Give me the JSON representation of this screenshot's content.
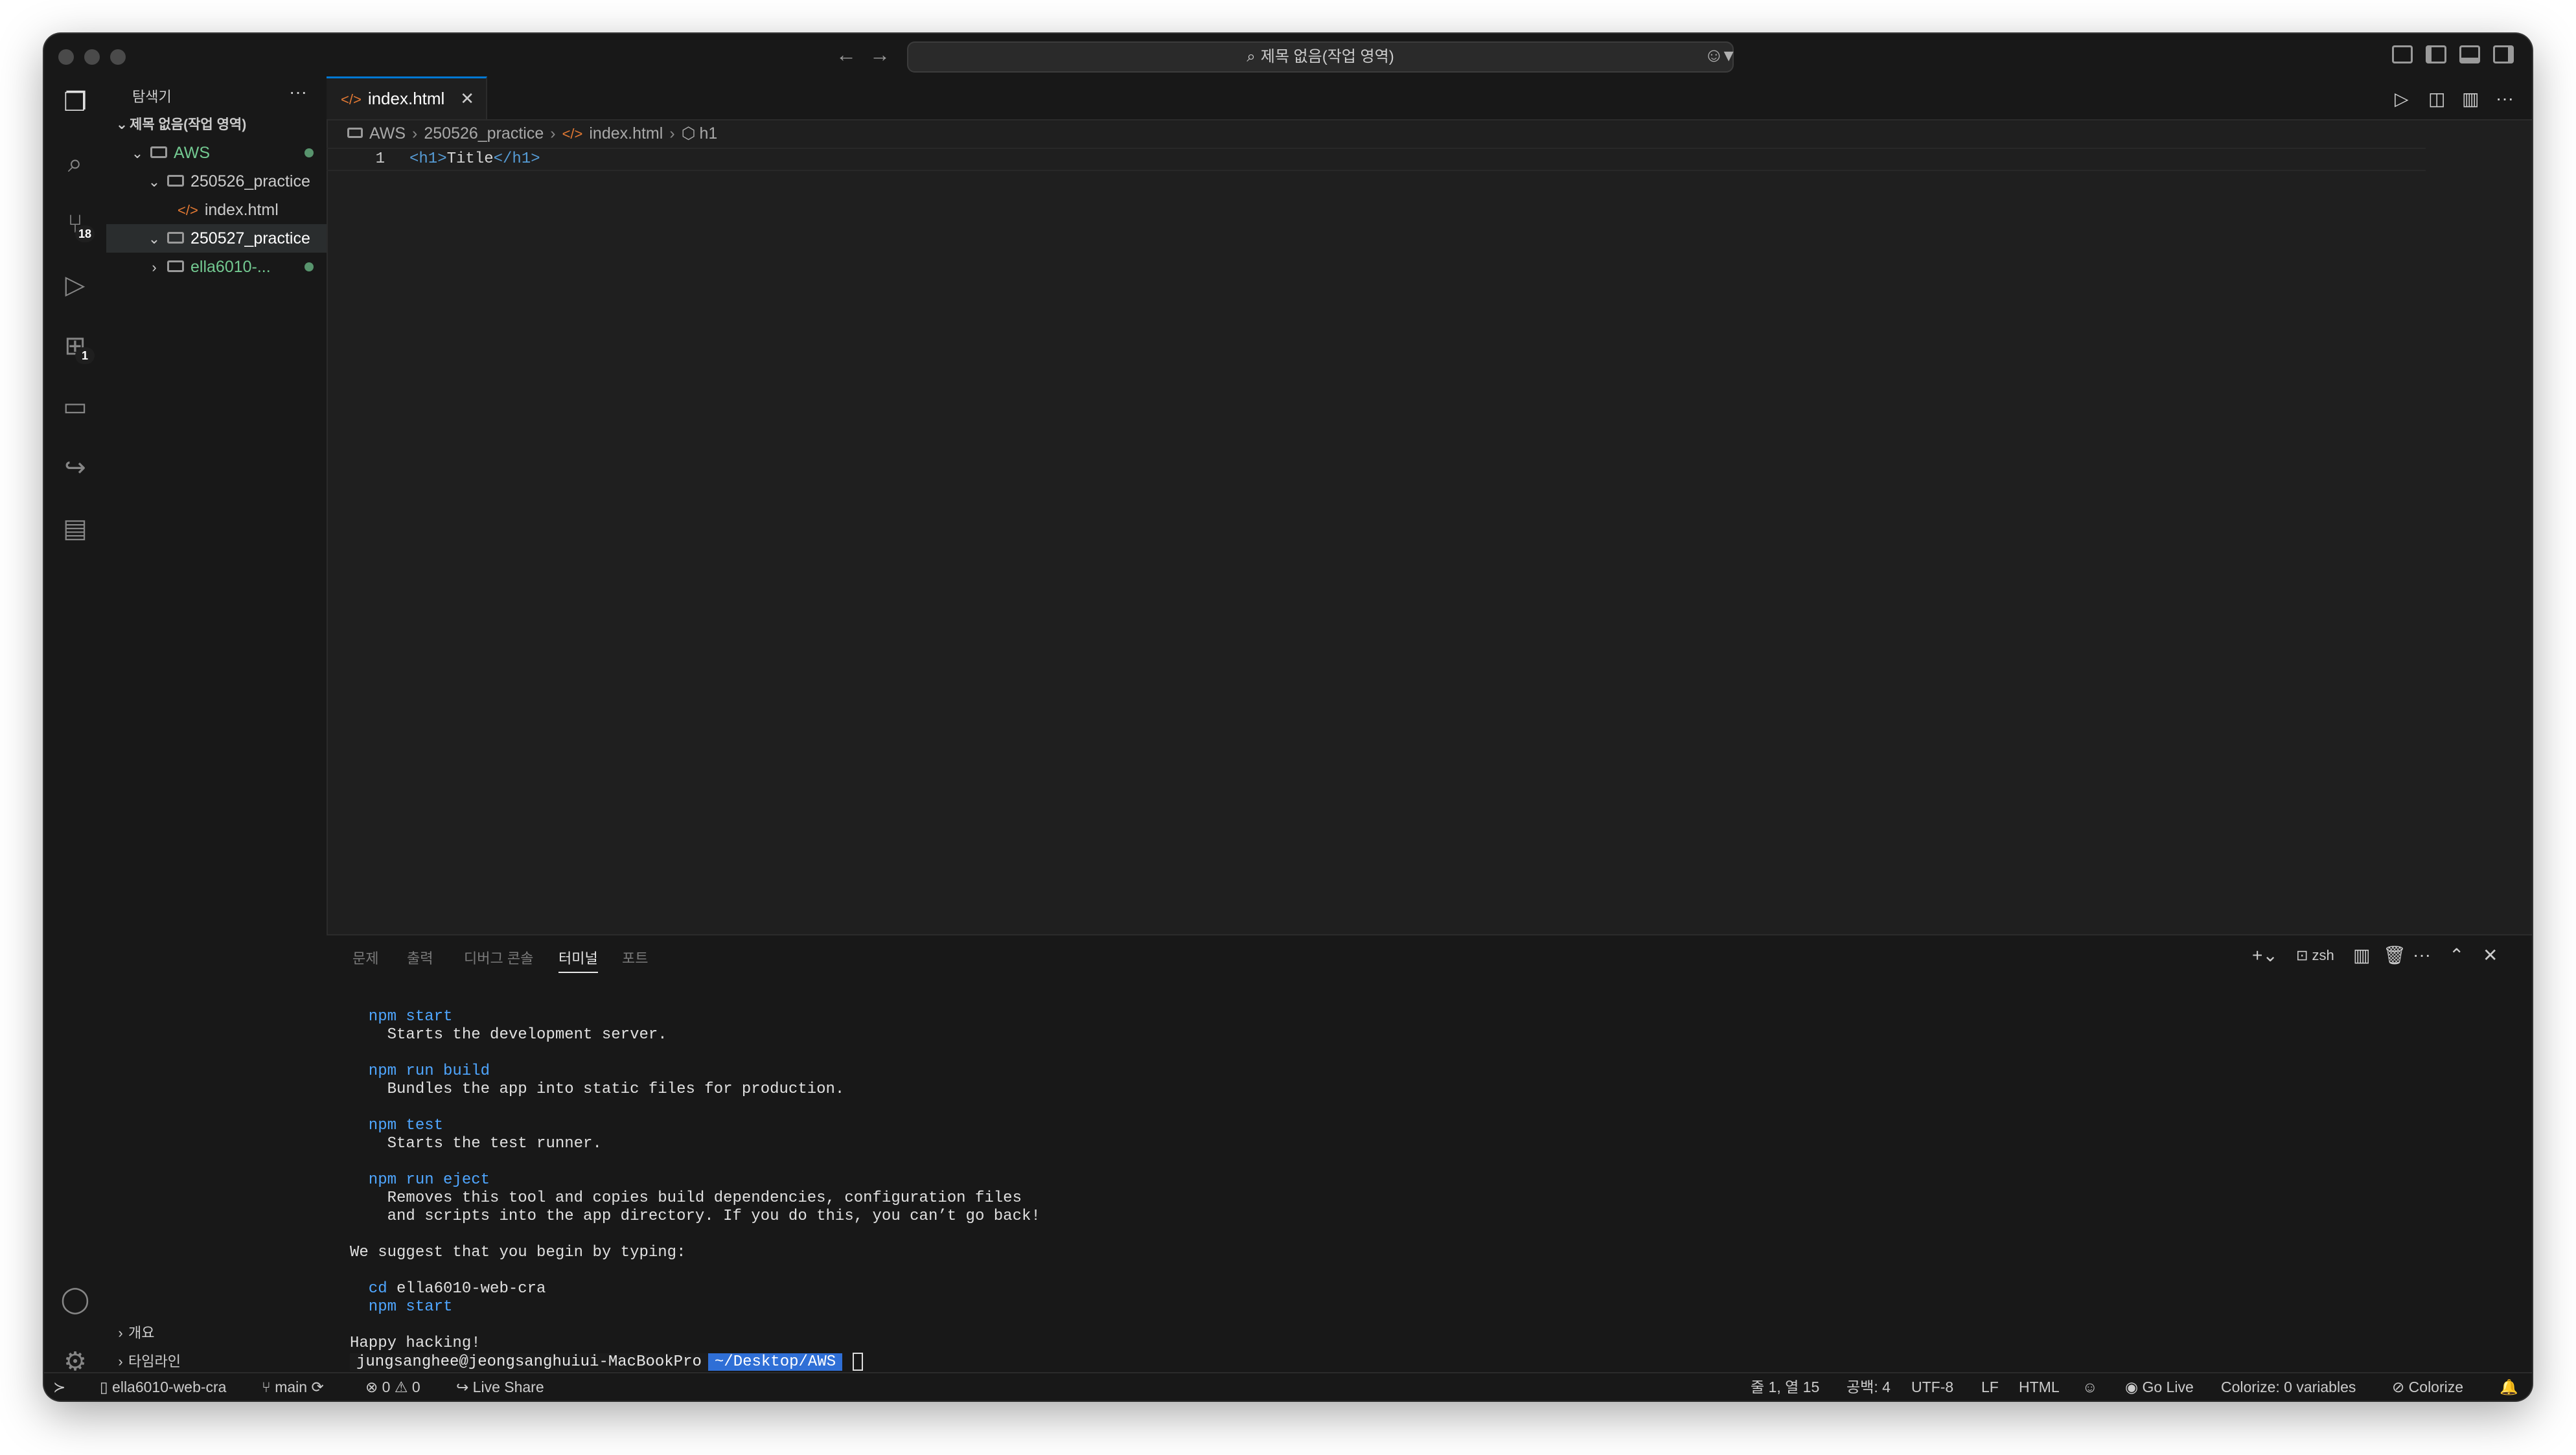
{
  "titlebar": {
    "command_center": "제목 없음(작업 영역)"
  },
  "activity_bar": {
    "badges": {
      "source_control": "18",
      "extensions": "1"
    }
  },
  "sidebar": {
    "title": "탐색기",
    "more": "···",
    "tree": [
      {
        "label": "제목 없음(작업 영역)"
      },
      {
        "label": "AWS"
      },
      {
        "label": "250526_practice"
      },
      {
        "label": "index.html"
      },
      {
        "label": "250527_practice"
      },
      {
        "label": "ella6010-..."
      }
    ],
    "bottom_sections": [
      "개요",
      "타임라인"
    ]
  },
  "editor": {
    "tab_label": "index.html",
    "breadcrumb": [
      "AWS",
      "250526_practice",
      "index.html",
      "h1"
    ],
    "lines": [
      {
        "number": "1",
        "open_tag": "<h1>",
        "text": "Title",
        "close_tag": "</h1>"
      }
    ]
  },
  "panel": {
    "tabs": [
      "문제",
      "출력",
      "디버그 콘솔",
      "터미널",
      "포트"
    ],
    "active_tab": "터미널",
    "shell": "zsh",
    "terminal_lines": [
      {
        "text": "  npm start",
        "kind": "cmd"
      },
      {
        "text": "    Starts the development server.",
        "kind": "plain"
      },
      {
        "text": "  npm run build",
        "kind": "cmd"
      },
      {
        "text": "    Bundles the app into static files for production.",
        "kind": "plain"
      },
      {
        "text": "  npm test",
        "kind": "cmd"
      },
      {
        "text": "    Starts the test runner.",
        "kind": "plain"
      },
      {
        "text": "  npm run eject",
        "kind": "cmd"
      },
      {
        "text": "    Removes this tool and copies build dependencies, configuration files",
        "kind": "plain"
      },
      {
        "text": "    and scripts into the app directory. If you do this, you can’t go back!",
        "kind": "plain"
      },
      {
        "text": "We suggest that you begin by typing:",
        "kind": "plain"
      },
      {
        "text": "  cd",
        "kind": "cmd",
        "rest": " ella6010-web-cra"
      },
      {
        "text": "  npm start",
        "kind": "cmd"
      },
      {
        "text": "Happy hacking!",
        "kind": "plain"
      }
    ],
    "prompt_user": "jungsanghee@jeongsanghuiui-MacBookPro",
    "prompt_dir": "~/Desktop/AWS"
  },
  "statusbar": {
    "repo": "ella6010-web-cra",
    "branch": "main",
    "errors": "0",
    "warnings": "0",
    "live_share": "Live Share",
    "position": "줄 1, 열 15",
    "spaces": "공백: 4",
    "encoding": "UTF-8",
    "eol": "LF",
    "language": "HTML",
    "go_live": "Go Live",
    "colorize_vars": "Colorize: 0 variables",
    "colorize": "Colorize"
  },
  "colors": {
    "accent": "#0078d4",
    "terminal_command": "#4fa6ff",
    "git_modified_dot": "#73c991"
  }
}
